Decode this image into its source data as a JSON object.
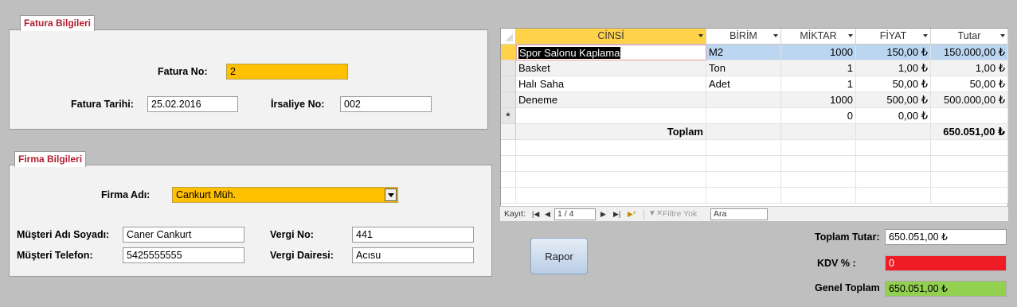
{
  "fatura": {
    "section_title": "Fatura Bilgileri",
    "no_label": "Fatura No:",
    "no_value": "2",
    "tarih_label": "Fatura Tarihi:",
    "tarih_value": "25.02.2016",
    "irsaliye_label": "İrsaliye No:",
    "irsaliye_value": "002"
  },
  "firma": {
    "section_title": "Firma Bilgileri",
    "adi_label": "Firma Adı:",
    "adi_value": "Cankurt Müh.",
    "musteri_label": "Müşteri Adı Soyadı:",
    "musteri_value": "Caner Cankurt",
    "telefon_label": "Müşteri Telefon:",
    "telefon_value": "5425555555",
    "vergi_no_label": "Vergi No:",
    "vergi_no_value": "441",
    "vergi_dairesi_label": "Vergi Dairesi:",
    "vergi_dairesi_value": "Acısu"
  },
  "grid": {
    "headers": [
      "CİNSİ",
      "BİRİM",
      "MİKTAR",
      "FİYAT",
      "Tutar"
    ],
    "rows": [
      {
        "cinsi": "Spor Salonu Kaplama",
        "birim": "M2",
        "miktar": "1000",
        "fiyat": "150,00 ₺",
        "tutar": "150.000,00 ₺"
      },
      {
        "cinsi": "Basket",
        "birim": "Ton",
        "miktar": "1",
        "fiyat": "1,00 ₺",
        "tutar": "1,00 ₺"
      },
      {
        "cinsi": "Halı Saha",
        "birim": "Adet",
        "miktar": "1",
        "fiyat": "50,00 ₺",
        "tutar": "50,00 ₺"
      },
      {
        "cinsi": "Deneme",
        "birim": "",
        "miktar": "1000",
        "fiyat": "500,00 ₺",
        "tutar": "500.000,00 ₺"
      }
    ],
    "new_row": {
      "marker": "*",
      "miktar": "0",
      "fiyat": "0,00 ₺"
    },
    "total_label": "Toplam",
    "total_value": "650.051,00 ₺"
  },
  "navigation": {
    "record_label": "Kayıt:",
    "record_position": "1 / 4",
    "filter_label": "Filtre Yok",
    "search_value": "Ara"
  },
  "rapor_label": "Rapor",
  "totals": {
    "toplam_tutar_label": "Toplam Tutar:",
    "toplam_tutar_value": "650.051,00 ₺",
    "kdv_label": "KDV % :",
    "kdv_value": "0",
    "genel_toplam_label": "Genel Toplam",
    "genel_toplam_value": "650.051,00 ₺"
  },
  "colors": {
    "background": "#bfbfbf",
    "section_title": "#b01c2e",
    "highlight_orange": "#ffc000",
    "kdv_red": "#ee1c24",
    "total_green": "#92d050",
    "selected_row": "#bcd6f2"
  }
}
